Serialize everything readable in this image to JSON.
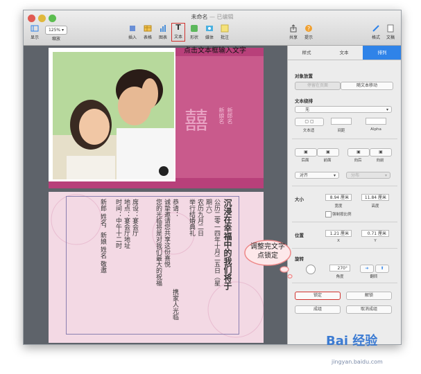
{
  "window": {
    "title": "未命名",
    "subtitle": "— 已编辑"
  },
  "toolbar": {
    "view_label": "显示",
    "zoom_value": "125%",
    "zoom_label": "缩放",
    "insert_label": "插入",
    "table_label": "表格",
    "chart_label": "图表",
    "text_label": "文本",
    "shape_label": "形状",
    "media_label": "媒体",
    "comment_label": "批注",
    "share_label": "共享",
    "tips_label": "提示",
    "format_label": "格式",
    "document_label": "文稿"
  },
  "annotation": {
    "top_text": "点击文本框输入文字",
    "callout_text": "调整完文字点锁定"
  },
  "card": {
    "xi_char": "囍",
    "side_text_1": "新郎名",
    "side_text_2": "新娘名",
    "line1": "沉浸在幸福中的我们将于",
    "line2": "公历二零一四年十月二五日（星",
    "line3": "期六）",
    "line4": "农历九月二日",
    "line5": "举行结婚典礼",
    "line6": "恭请：",
    "line7": "携家人光临",
    "line8": "诚挚邀请您共享这份喜悦",
    "line9": "您的光临将是对我们最大的祝福",
    "line10": "席设：宴会厅",
    "line11": "地点：宴会厅地址",
    "line12": "时间：中午十二时",
    "line13": "新郎 姓名，新娘 姓名 敬邀"
  },
  "sidebar": {
    "tabs": [
      "样式",
      "文本",
      "排列"
    ],
    "object_placement": "对象放置",
    "stay_on_page": "停留在页面",
    "move_with_text": "随文本移动",
    "text_wrap": "文本绕排",
    "wrap_value": "无",
    "text_fit": "文本适",
    "spacing": "间距",
    "alpha": "Alpha",
    "back": "后面",
    "front": "前面",
    "backward": "向后",
    "forward": "向前",
    "align": "对齐",
    "distribute": "分布",
    "size": "大小",
    "width_value": "8.94 厘米",
    "height_value": "11.84 厘米",
    "width_label": "宽度",
    "height_label": "高度",
    "constrain": "强制按比例",
    "position": "位置",
    "x_value": "1.21 厘米",
    "y_value": "0.71 厘米",
    "x_label": "X",
    "y_label": "Y",
    "rotate": "旋转",
    "angle_value": "270°",
    "angle_label": "角度",
    "flip_label": "翻转",
    "lock": "锁定",
    "unlock": "解锁",
    "group": "成组",
    "ungroup": "取消成组"
  },
  "watermark": {
    "brand": "Bai 经验",
    "url": "jingyan.baidu.com"
  },
  "colors": {
    "accent": "#2f83e8",
    "card_magenta": "#b8407a",
    "card_pink": "#f3d9e4",
    "highlight_red": "#d0312d"
  }
}
